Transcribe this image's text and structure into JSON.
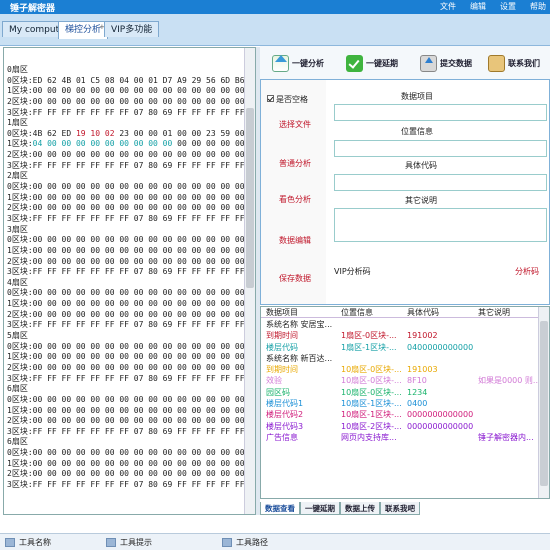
{
  "app": {
    "title": "锤子解密器",
    "menu": [
      "文件",
      "编辑",
      "设置",
      "帮助"
    ]
  },
  "tabs": [
    {
      "label": "My compute"
    },
    {
      "label": "梯控分析",
      "active": true
    },
    {
      "label": "VIP多功能"
    }
  ],
  "hex_lines": [
    {
      "text": "0扇区"
    },
    {
      "text": "0区块:ED 62 4B 01 C5 08 04 00 01 D7 A9 29 56 6D B6 1D"
    },
    {
      "text": "1区块:00 00 00 00 00 00 00 00 00 00 00 00 00 00 00 00"
    },
    {
      "text": "2区块:00 00 00 00 00 00 00 00 00 00 00 00 00 00 00 00"
    },
    {
      "text": "3区块:FF FF FF FF FF FF FF 07 80 69 FF FF FF FF FF FF"
    },
    {
      "text": "1扇区"
    },
    {
      "text": "0区块:4B 62 ED ",
      "red": "19 10 02",
      "rest": " 23 00 00 01 00 00 23 59 00 00"
    },
    {
      "text": "1区块:",
      "teal": "04 00 00 00 00 00 00 00 00 00",
      "rest": " 00 00 00 00 00 00"
    },
    {
      "text": "2区块:00 00 00 00 00 00 00 00 00 00 00 00 00 00 00 00"
    },
    {
      "text": "3区块:FF FF FF FF FF FF FF 07 80 69 FF FF FF FF FF FF"
    },
    {
      "text": "2扇区"
    },
    {
      "text": "0区块:00 00 00 00 00 00 00 00 00 00 00 00 00 00 00 00"
    },
    {
      "text": "1区块:00 00 00 00 00 00 00 00 00 00 00 00 00 00 00 00"
    },
    {
      "text": "2区块:00 00 00 00 00 00 00 00 00 00 00 00 00 00 00 00"
    },
    {
      "text": "3区块:FF FF FF FF FF FF FF 07 80 69 FF FF FF FF FF FF"
    },
    {
      "text": "3扇区"
    },
    {
      "text": "0区块:00 00 00 00 00 00 00 00 00 00 00 00 00 00 00 00"
    },
    {
      "text": "1区块:00 00 00 00 00 00 00 00 00 00 00 00 00 00 00 00"
    },
    {
      "text": "2区块:00 00 00 00 00 00 00 00 00 00 00 00 00 00 00 00"
    },
    {
      "text": "3区块:FF FF FF FF FF FF FF 07 80 69 FF FF FF FF FF FF"
    },
    {
      "text": "4扇区"
    },
    {
      "text": "0区块:00 00 00 00 00 00 00 00 00 00 00 00 00 00 00 00"
    },
    {
      "text": "1区块:00 00 00 00 00 00 00 00 00 00 00 00 00 00 00 00"
    },
    {
      "text": "2区块:00 00 00 00 00 00 00 00 00 00 00 00 00 00 00 00"
    },
    {
      "text": "3区块:FF FF FF FF FF FF FF 07 80 69 FF FF FF FF FF FF"
    },
    {
      "text": "5扇区"
    },
    {
      "text": "0区块:00 00 00 00 00 00 00 00 00 00 00 00 00 00 00 00"
    },
    {
      "text": "1区块:00 00 00 00 00 00 00 00 00 00 00 00 00 00 00 00"
    },
    {
      "text": "2区块:00 00 00 00 00 00 00 00 00 00 00 00 00 00 00 00"
    },
    {
      "text": "3区块:FF FF FF FF FF FF FF 07 80 69 FF FF FF FF FF FF"
    },
    {
      "text": "6扇区"
    },
    {
      "text": "0区块:00 00 00 00 00 00 00 00 00 00 00 00 00 00 00 00"
    },
    {
      "text": "1区块:00 00 00 00 00 00 00 00 00 00 00 00 00 00 00 00"
    },
    {
      "text": "2区块:00 00 00 00 00 00 00 00 00 00 00 00 00 00 00 00"
    },
    {
      "text": "3区块:FF FF FF FF FF FF FF 07 80 69 FF FF FF FF FF FF"
    },
    {
      "text": "6扇区"
    },
    {
      "text": "0区块:00 00 00 00 00 00 00 00 00 00 00 00 00 00 00 00"
    },
    {
      "text": "1区块:00 00 00 00 00 00 00 00 00 00 00 00 00 00 00 00"
    },
    {
      "text": "2区块:00 00 00 00 00 00 00 00 00 00 00 00 00 00 00 00"
    },
    {
      "text": "3区块:FF FF FF FF FF FF FF 07 80 69 FF FF FF FF FF FF"
    }
  ],
  "toolbar": {
    "analyze_label": "一键分析",
    "extend_label": "一键延期",
    "submit_label": "提交数据",
    "contact_label": "联系我们"
  },
  "form": {
    "checkbox_label": "是否空格",
    "btn_select_file": "选择文件",
    "btn_normal_analyze": "普通分析",
    "btn_view_analyze": "看色分析",
    "btn_data_edit": "数据编辑",
    "btn_save_data": "保存数据",
    "field1_label": "数据项目",
    "field2_label": "位置信息",
    "field3_label": "具体代码",
    "field4_label": "其它说明",
    "vip_label": "VIP分析码",
    "analyze_code_label": "分析码"
  },
  "result_table": {
    "headers": [
      "数据项目",
      "位置信息",
      "具体代码",
      "其它说明"
    ],
    "rows": [
      {
        "cells": [
          "系统名称 安居宝...",
          "",
          "",
          ""
        ],
        "color": "#222222"
      },
      {
        "cells": [
          "到期时间",
          "1扇区-0区块-...",
          "191002",
          ""
        ],
        "color": "#c0162a"
      },
      {
        "cells": [
          "楼层代码",
          "1扇区-1区块-...",
          "0400000000000...",
          ""
        ],
        "color": "#14a0a6"
      },
      {
        "cells": [
          "系统名称 新百达...",
          "",
          "",
          ""
        ],
        "color": "#222222"
      },
      {
        "cells": [
          "到期时间",
          "10扇区-0区块-...",
          "191003",
          ""
        ],
        "color": "#e8a800"
      },
      {
        "cells": [
          "效验",
          "10扇区-0区块-...",
          "8F10",
          "如果是0000 则..."
        ],
        "color": "#d27ad6"
      },
      {
        "cells": [
          "园区码",
          "10扇区-0区块-...",
          "1234",
          ""
        ],
        "color": "#19b36b"
      },
      {
        "cells": [
          "楼层代码1",
          "10扇区-1区块-...",
          "0400",
          ""
        ],
        "color": "#1a8fd6"
      },
      {
        "cells": [
          "楼层代码2",
          "10扇区-1区块-...",
          "0000000000000",
          ""
        ],
        "color": "#d01a7a"
      },
      {
        "cells": [
          "楼层代码3",
          "10扇区-2区块-...",
          "0000000000000",
          ""
        ],
        "color": "#8a1ad0"
      },
      {
        "cells": [
          "广告信息",
          "网页内支持库...",
          "",
          "锤子解密器内..."
        ],
        "color": "#8a1ad0"
      }
    ]
  },
  "bottom_tabs": [
    {
      "label": "数据查看",
      "active": true
    },
    {
      "label": "一键延期"
    },
    {
      "label": "数据上传"
    },
    {
      "label": "联系我吧"
    }
  ],
  "statusbar": {
    "item1": "工具名称",
    "item2": "工具提示",
    "item3": "工具路径"
  },
  "colors": {
    "accent": "#1b7fd3",
    "red": "#c0162a",
    "teal": "#14a0a6"
  }
}
